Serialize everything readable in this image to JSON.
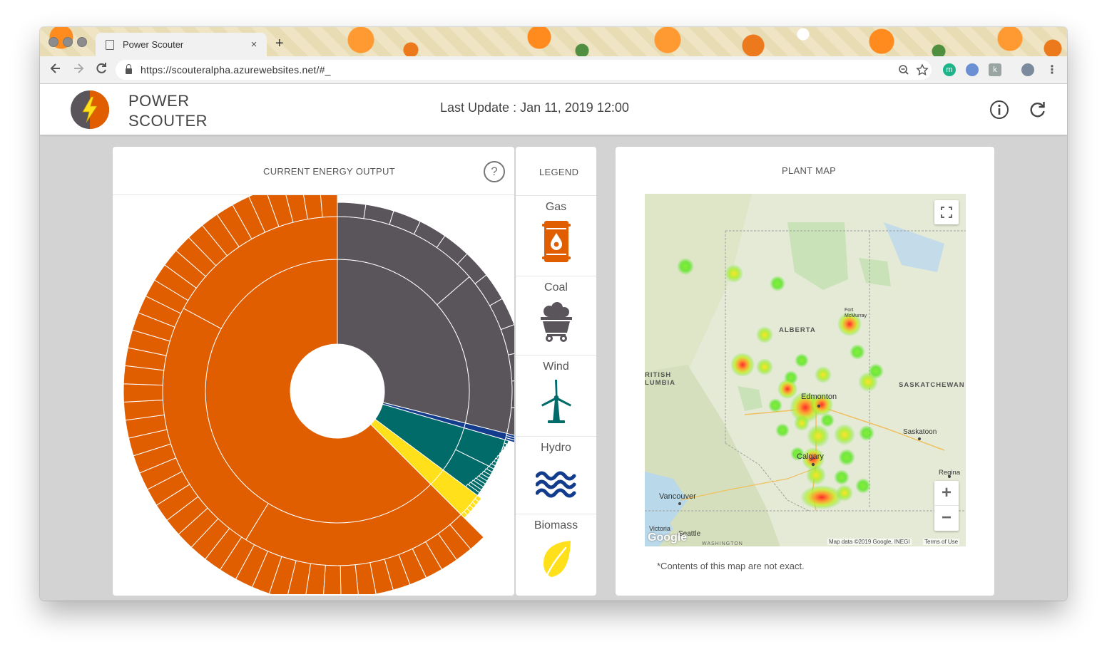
{
  "browser": {
    "tab_title": "Power Scouter",
    "tab_close": "×",
    "new_tab": "+",
    "url": "https://scouteralpha.azurewebsites.net/#_",
    "ext_m": "m",
    "ext_k": "k"
  },
  "app": {
    "brand_line1": "POWER",
    "brand_line2": "SCOUTER",
    "last_update": "Last Update : Jan 11, 2019 12:00"
  },
  "energy_card": {
    "title": "CURRENT ENERGY OUTPUT",
    "help": "?"
  },
  "legend": {
    "title": "LEGEND",
    "items": [
      {
        "label": "Gas",
        "icon": "oil-barrel-icon",
        "color": "#e05d00"
      },
      {
        "label": "Coal",
        "icon": "coal-cart-icon",
        "color": "#5a555b"
      },
      {
        "label": "Wind",
        "icon": "wind-turbine-icon",
        "color": "#006b68"
      },
      {
        "label": "Hydro",
        "icon": "water-waves-icon",
        "color": "#143c8c"
      },
      {
        "label": "Biomass",
        "icon": "leaf-icon",
        "color": "#ffe01a"
      }
    ]
  },
  "map_card": {
    "title": "PLANT MAP",
    "note": "*Contents of this map are not exact.",
    "labels": {
      "alberta": "ALBERTA",
      "bc1": "RITISH",
      "bc2": "LUMBIA",
      "sask": "SASKATCHEWAN",
      "edmonton": "Edmonton",
      "calgary": "Calgary",
      "saskatoon": "Saskatoon",
      "regina": "Regina",
      "vancouver": "Vancouver",
      "victoria": "Victoria",
      "seattle": "Seattle",
      "washington": "WASHINGTON",
      "fortmc1": "Fort",
      "fortmc2": "McMurray",
      "google": "Google",
      "attribution": "Map data ©2019 Google, INEGI",
      "terms": "Terms of Use",
      "zoom_in": "+",
      "zoom_out": "−"
    }
  },
  "chart_data": {
    "type": "sunburst",
    "segments": [
      {
        "name": "Gas",
        "color": "#e05d00",
        "share": 0.625
      },
      {
        "name": "Coal",
        "color": "#5a555b",
        "share": 0.289
      },
      {
        "name": "Hydro",
        "color": "#143c8c",
        "share": 0.006
      },
      {
        "name": "Wind",
        "color": "#006b68",
        "share": 0.057
      },
      {
        "name": "Biomass",
        "color": "#ffe01a",
        "share": 0.023
      }
    ]
  }
}
